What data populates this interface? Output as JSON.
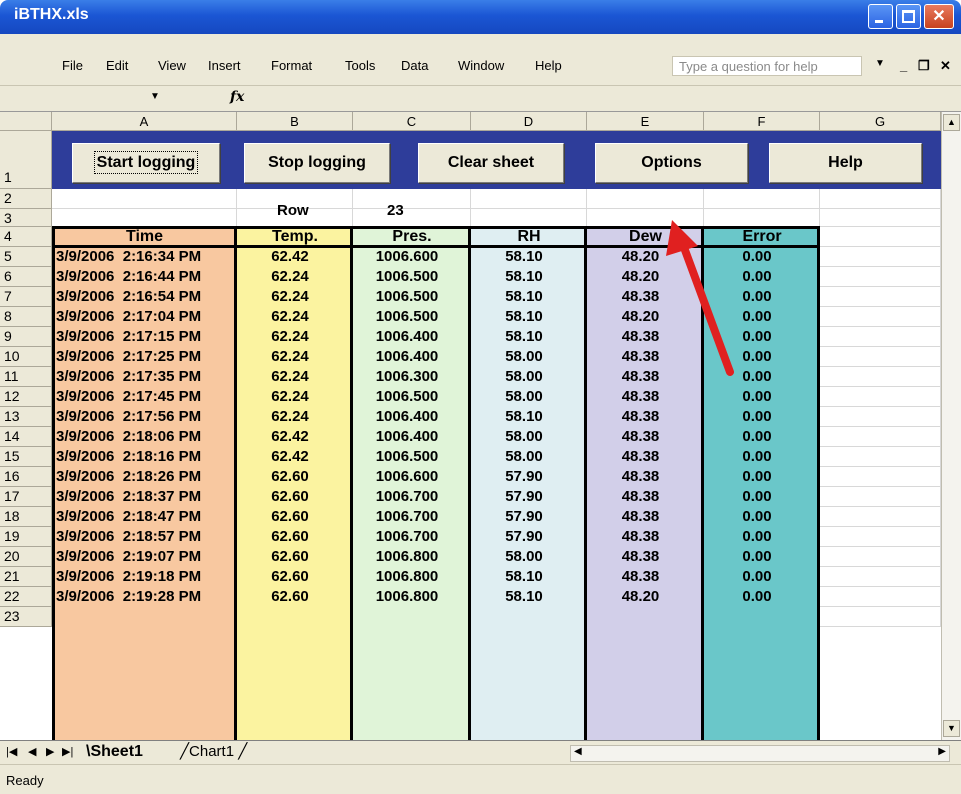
{
  "window": {
    "title": "iBTHX.xls"
  },
  "menu": {
    "items": [
      "File",
      "Edit",
      "View",
      "Insert",
      "Format",
      "Tools",
      "Data",
      "Window",
      "Help"
    ],
    "help_placeholder": "Type a question for help"
  },
  "formula_bar": {
    "fx": "fx"
  },
  "columns": [
    "A",
    "B",
    "C",
    "D",
    "E",
    "F",
    "G"
  ],
  "row_numbers": [
    "1",
    "2",
    "3",
    "4",
    "5",
    "6",
    "7",
    "8",
    "9",
    "10",
    "11",
    "12",
    "13",
    "14",
    "15",
    "16",
    "17",
    "18",
    "19",
    "20",
    "21",
    "22",
    "23"
  ],
  "buttons": {
    "start": "Start logging",
    "stop": "Stop logging",
    "clear": "Clear sheet",
    "options": "Options",
    "help": "Help"
  },
  "row2": {
    "label": "Row",
    "value": "23"
  },
  "table": {
    "headers": [
      "Time",
      "Temp.",
      "Pres.",
      "RH",
      "Dew",
      "Error"
    ],
    "header_colors": [
      "#f8c8a0",
      "#fbf3a0",
      "#e0f4d8",
      "#dfeef2",
      "#d2cfe9",
      "#6ac7c9"
    ],
    "rows": [
      [
        "3/9/2006  2:16:34 PM",
        "62.42",
        "1006.600",
        "58.10",
        "48.20",
        "0.00"
      ],
      [
        "3/9/2006  2:16:44 PM",
        "62.24",
        "1006.500",
        "58.10",
        "48.20",
        "0.00"
      ],
      [
        "3/9/2006  2:16:54 PM",
        "62.24",
        "1006.500",
        "58.10",
        "48.38",
        "0.00"
      ],
      [
        "3/9/2006  2:17:04 PM",
        "62.24",
        "1006.500",
        "58.10",
        "48.20",
        "0.00"
      ],
      [
        "3/9/2006  2:17:15 PM",
        "62.24",
        "1006.400",
        "58.10",
        "48.38",
        "0.00"
      ],
      [
        "3/9/2006  2:17:25 PM",
        "62.24",
        "1006.400",
        "58.00",
        "48.38",
        "0.00"
      ],
      [
        "3/9/2006  2:17:35 PM",
        "62.24",
        "1006.300",
        "58.00",
        "48.38",
        "0.00"
      ],
      [
        "3/9/2006  2:17:45 PM",
        "62.24",
        "1006.500",
        "58.00",
        "48.38",
        "0.00"
      ],
      [
        "3/9/2006  2:17:56 PM",
        "62.24",
        "1006.400",
        "58.10",
        "48.38",
        "0.00"
      ],
      [
        "3/9/2006  2:18:06 PM",
        "62.42",
        "1006.400",
        "58.00",
        "48.38",
        "0.00"
      ],
      [
        "3/9/2006  2:18:16 PM",
        "62.42",
        "1006.500",
        "58.00",
        "48.38",
        "0.00"
      ],
      [
        "3/9/2006  2:18:26 PM",
        "62.60",
        "1006.600",
        "57.90",
        "48.38",
        "0.00"
      ],
      [
        "3/9/2006  2:18:37 PM",
        "62.60",
        "1006.700",
        "57.90",
        "48.38",
        "0.00"
      ],
      [
        "3/9/2006  2:18:47 PM",
        "62.60",
        "1006.700",
        "57.90",
        "48.38",
        "0.00"
      ],
      [
        "3/9/2006  2:18:57 PM",
        "62.60",
        "1006.700",
        "57.90",
        "48.38",
        "0.00"
      ],
      [
        "3/9/2006  2:19:07 PM",
        "62.60",
        "1006.800",
        "58.00",
        "48.38",
        "0.00"
      ],
      [
        "3/9/2006  2:19:18 PM",
        "62.60",
        "1006.800",
        "58.10",
        "48.38",
        "0.00"
      ],
      [
        "3/9/2006  2:19:28 PM",
        "62.60",
        "1006.800",
        "58.10",
        "48.20",
        "0.00"
      ]
    ]
  },
  "sheet_tabs": [
    "Sheet1",
    "Chart1"
  ],
  "active_tab": "Sheet1",
  "status": "Ready",
  "colors": {
    "button_bar": "#2e3d9a",
    "annotation_arrow": "#e02020"
  },
  "annotation": {
    "arrow_icon": "red-arrow-icon"
  }
}
